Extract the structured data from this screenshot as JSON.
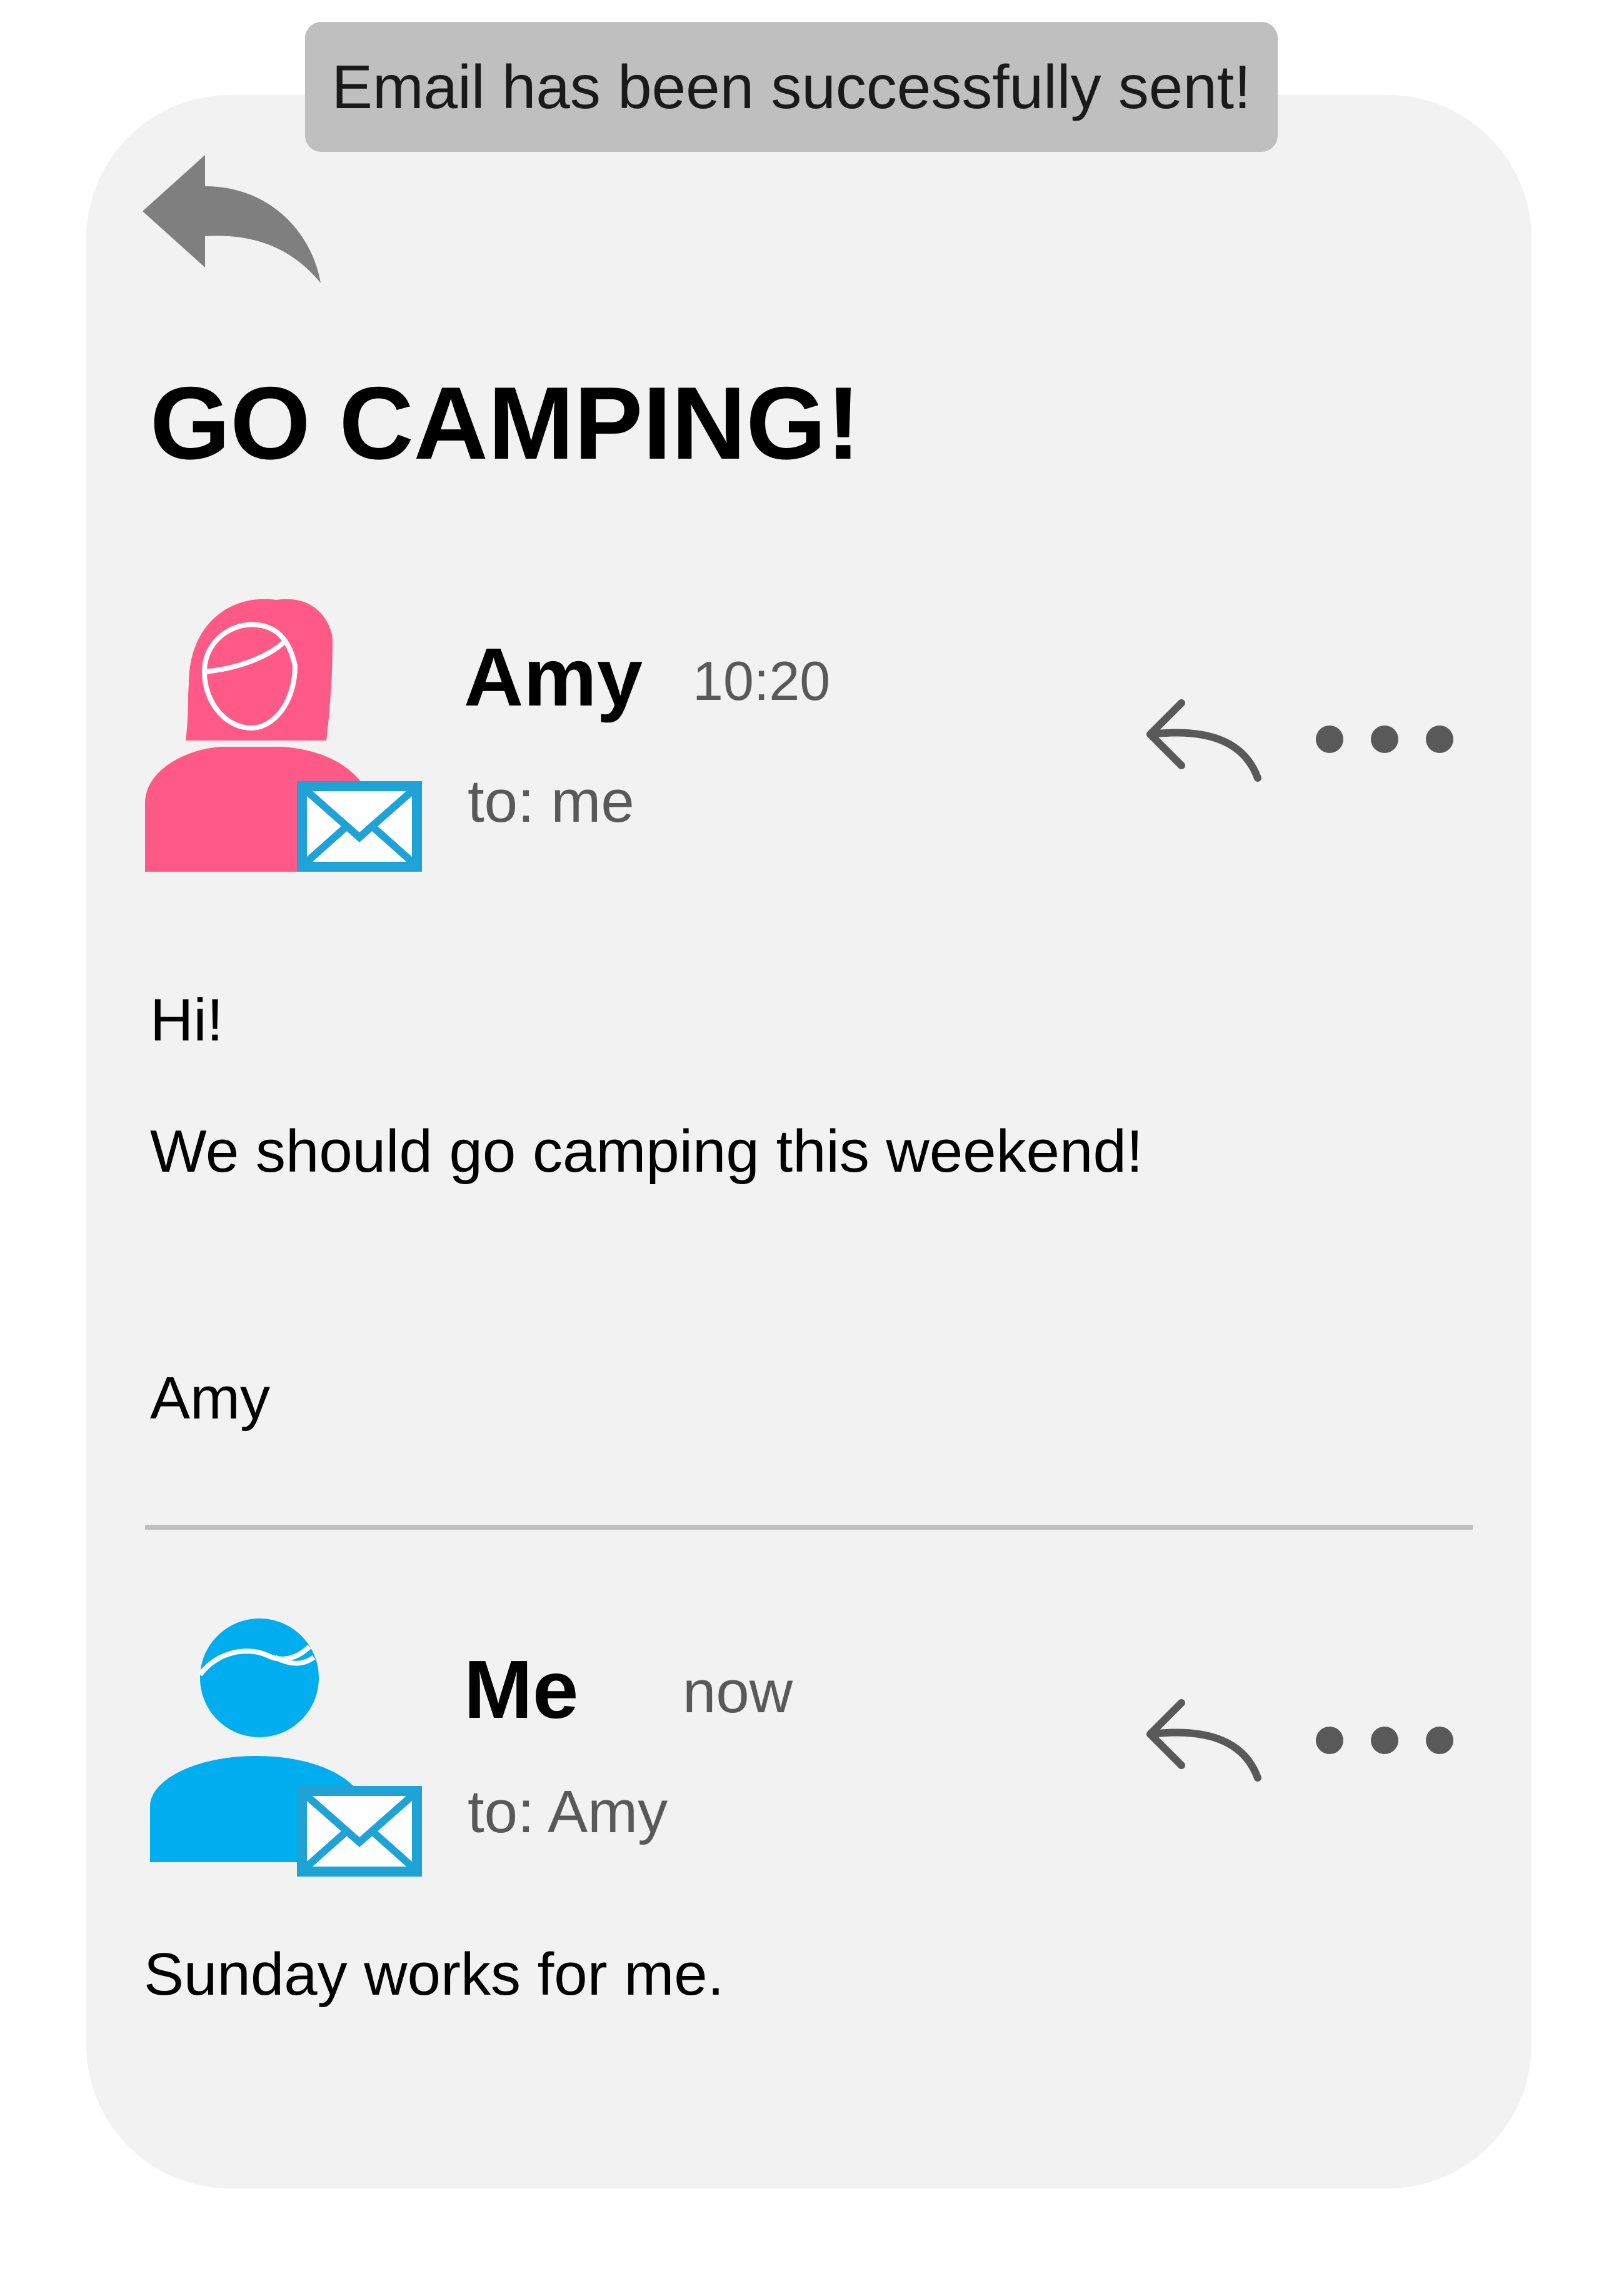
{
  "toast": {
    "message": "Email has been successfully sent!"
  },
  "thread": {
    "subject": "GO CAMPING!"
  },
  "messages": [
    {
      "sender": "Amy",
      "time": "10:20",
      "recipient": "to: me",
      "body": [
        "Hi!",
        "We should go camping this weekend!",
        "Amy"
      ],
      "avatar_color": "#ff5a87"
    },
    {
      "sender": "Me",
      "time": "now",
      "recipient": "to: Amy",
      "body": [
        "Sunday works for me."
      ],
      "avatar_color": "#00aeef"
    }
  ],
  "icons": {
    "back": "back-arrow-icon",
    "reply": "reply-icon",
    "more": "more-options-icon",
    "mail_badge": "envelope-icon"
  },
  "colors": {
    "card_background": "#f2f2f2",
    "toast_background": "#bfbfbf",
    "envelope_blue": "#1fa3d6",
    "icon_gray": "#595959"
  }
}
